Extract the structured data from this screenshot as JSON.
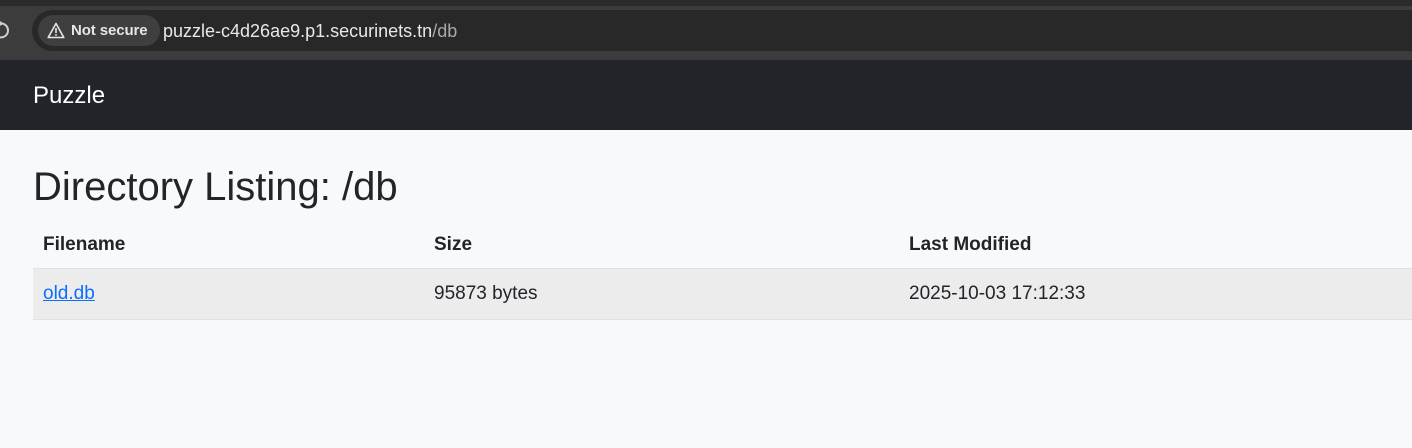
{
  "browser": {
    "security_chip_label": "Not secure",
    "url_host": "puzzle-c4d26ae9.p1.securinets.tn",
    "url_path": "/db",
    "icons": {
      "reload": "reload-icon",
      "warning": "warning-triangle-icon"
    }
  },
  "navbar": {
    "brand": "Puzzle",
    "background_color": "#212529"
  },
  "main": {
    "title": "Directory Listing: /db",
    "table": {
      "columns": [
        "Filename",
        "Size",
        "Last Modified"
      ],
      "rows": [
        {
          "filename": "old.db",
          "size": "95873 bytes",
          "last_modified": "2025-10-03 17:12:33"
        }
      ]
    }
  },
  "colors": {
    "link": "#0d6efd",
    "page_background": "#f8f9fa",
    "row_background": "#ececed"
  }
}
